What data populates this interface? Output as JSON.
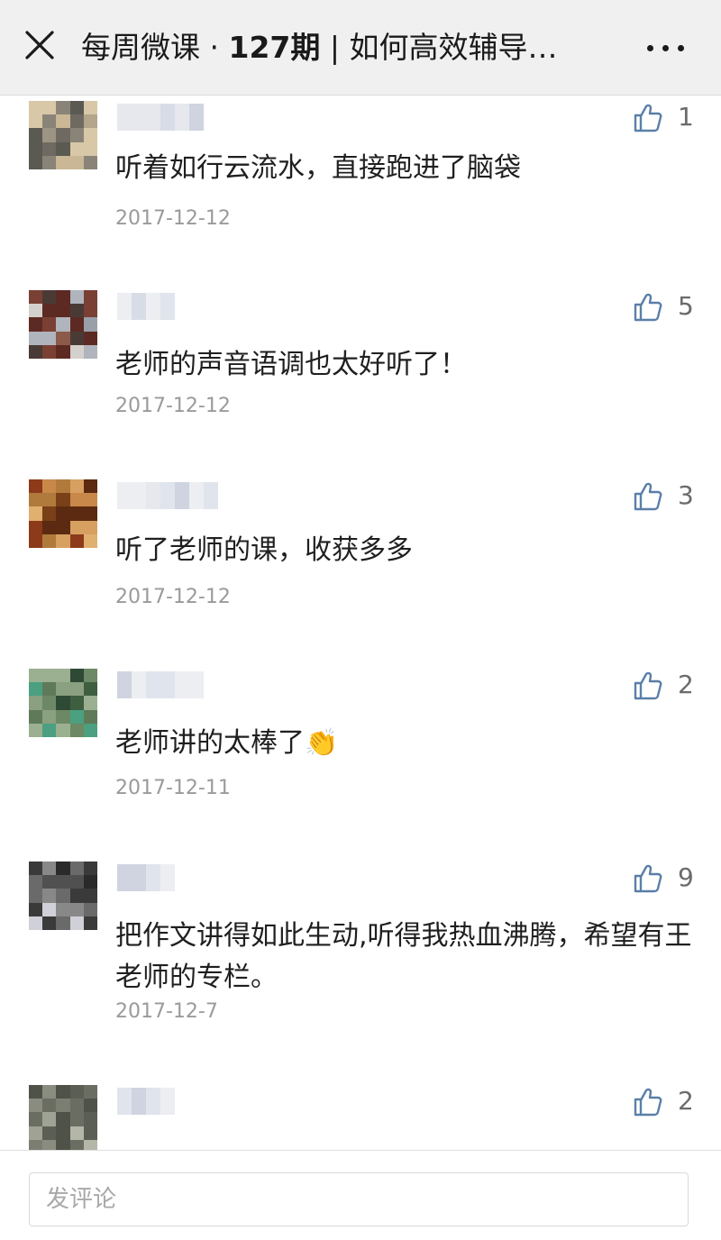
{
  "header": {
    "title_prefix": "每周微课 · ",
    "title_issue": "127期",
    "title_suffix": " | 如何高效辅导…"
  },
  "comments": [
    {
      "text": "听着如行云流水，直接跑进了脑袋",
      "date": "2017-12-12",
      "likes": "1"
    },
    {
      "text": "老师的声音语调也太好听了！",
      "date": "2017-12-12",
      "likes": "5"
    },
    {
      "text": "听了老师的课，收获多多",
      "date": "2017-12-12",
      "likes": "3"
    },
    {
      "text": "老师讲的太棒了👏",
      "date": "2017-12-11",
      "likes": "2"
    },
    {
      "text": "把作文讲得如此生动,听得我热血沸腾，希望有王老师的专栏。",
      "date": "2017-12-7",
      "likes": "9"
    },
    {
      "text": "",
      "date": "",
      "likes": "2"
    }
  ],
  "input": {
    "placeholder": "发评论"
  },
  "colors": {
    "header_bg": "#f0f0f0",
    "like_icon": "#5a7fa8",
    "date_text": "#9a9a9a"
  },
  "icons": {
    "close": "close-icon",
    "more": "more-icon",
    "like": "thumbs-up-icon"
  }
}
